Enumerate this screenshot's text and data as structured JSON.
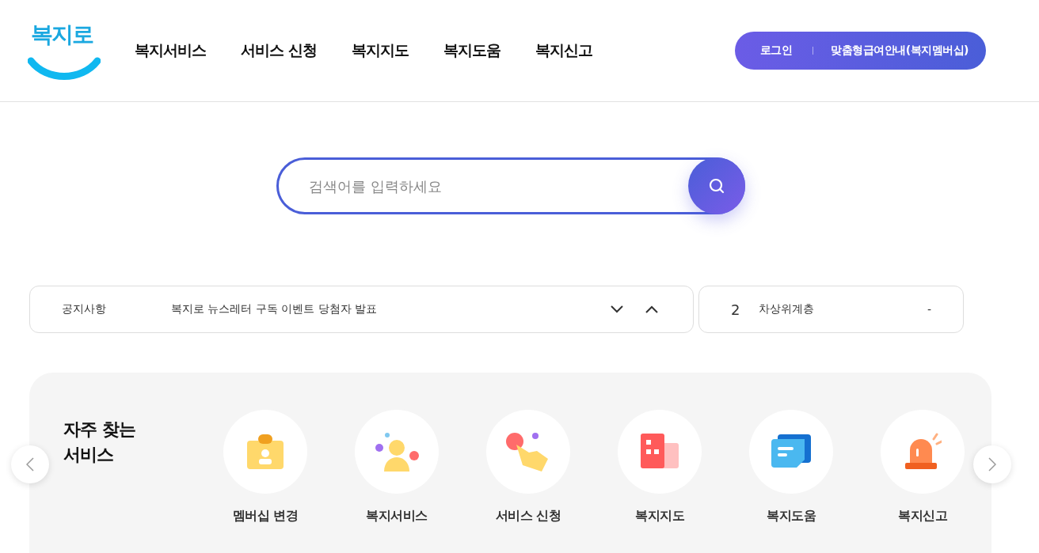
{
  "header": {
    "logo": "복지로",
    "nav": [
      "복지서비스",
      "서비스 신청",
      "복지지도",
      "복지도움",
      "복지신고"
    ],
    "login": "로그인",
    "membership": "맞춤형급여안내(복지멤버십)"
  },
  "search": {
    "placeholder": "검색어를 입력하세요"
  },
  "notice": {
    "label": "공지사항",
    "text": "복지로 뉴스레터 구독 이벤트 당첨자 발표"
  },
  "ranking": {
    "rank": "2",
    "keyword": "차상위계층",
    "change": "-"
  },
  "services": {
    "title": "자주 찾는\n서비스",
    "items": [
      "멤버십 변경",
      "복지서비스",
      "서비스 신청",
      "복지지도",
      "복지도움",
      "복지신고"
    ]
  }
}
